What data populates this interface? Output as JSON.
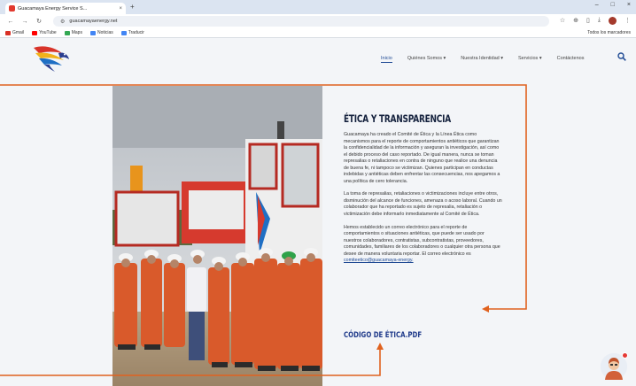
{
  "browser": {
    "tab_title": "Guacamaya Energy Service S...",
    "tab_close": "×",
    "new_tab": "+",
    "window_controls": [
      "–",
      "□",
      "×"
    ],
    "url": "guacamayaenergy.net",
    "bookmarks": [
      {
        "label": "Gmail",
        "color": "#d93025"
      },
      {
        "label": "YouTube",
        "color": "#ff0000"
      },
      {
        "label": "Maps",
        "color": "#34a853"
      },
      {
        "label": "Noticias",
        "color": "#4285f4"
      },
      {
        "label": "Traducir",
        "color": "#4285f4"
      }
    ],
    "all_bookmarks": "Todos los marcadores"
  },
  "nav": {
    "items": [
      {
        "label": "Inicio",
        "active": true
      },
      {
        "label": "Quiénes Somos ▾",
        "active": false
      },
      {
        "label": "Nuestra Identidad ▾",
        "active": false
      },
      {
        "label": "Servicios ▾",
        "active": false
      },
      {
        "label": "Contáctenos",
        "active": false
      }
    ]
  },
  "content": {
    "heading": "ÉTICA Y TRANSPARENCIA",
    "para1": "Guacamaya ha creado el Comité de Ética y la Línea Ética como mecanismos para el reporte de comportamientos antiéticos que garantizan la confidencialidad de la información y aseguran la investigación, así como el debido proceso del caso reportado. De igual manera, nunca se toman represalias o retaliaciones en contra de ninguno que realice una denuncia de buena fe, ni tampoco se victimizan. Quienes participan en conductas indebidas y antiéticas deben enfrentar las consecuencias, nos apegamos a una política de cero tolerancia.",
    "para2": "La toma de represalias, retaliaciones o victimizaciones incluye entre otros, disminución del alcance de funciones, amenaza o acoso laboral. Cuando un colaborador que ha reportado es sujeto de represalia, retaliación o victimización debe informarlo inmediatamente al Comité de Ética.",
    "para3": "Hemos establecido un correo electrónico para el reporte de comportamientos o situaciones antiéticas, que puede ser usado por nuestros colaboradores, contratistas, subcontratistas, proveedores, comunidades, familiares de los colaboradores o cualquier otra persona que desee de manera voluntaria reportar. El correo electrónico es",
    "email": "comiteetico@guacamaya-energy.",
    "pdf_link": "CÓDIGO DE ÉTICA.PDF"
  },
  "colors": {
    "accent": "#1f4a94",
    "annotation": "#e0621f",
    "heading": "#14213d"
  }
}
